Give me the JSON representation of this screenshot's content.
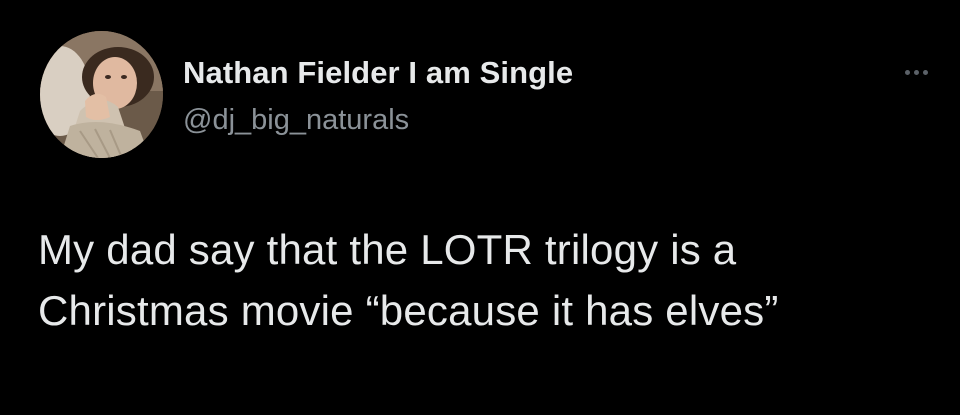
{
  "tweet": {
    "author": {
      "display_name": "Nathan Fielder I am Single",
      "handle": "@dj_big_naturals",
      "avatar_icon": "profile-photo"
    },
    "more_icon": "more-options-icon",
    "text_lines": [
      "My dad say that the LOTR trilogy is a",
      "Christmas movie “because it has elves”"
    ]
  },
  "colors": {
    "background": "#000000",
    "primary_text": "#e7e9ea",
    "secondary_text": "#8b9298"
  }
}
